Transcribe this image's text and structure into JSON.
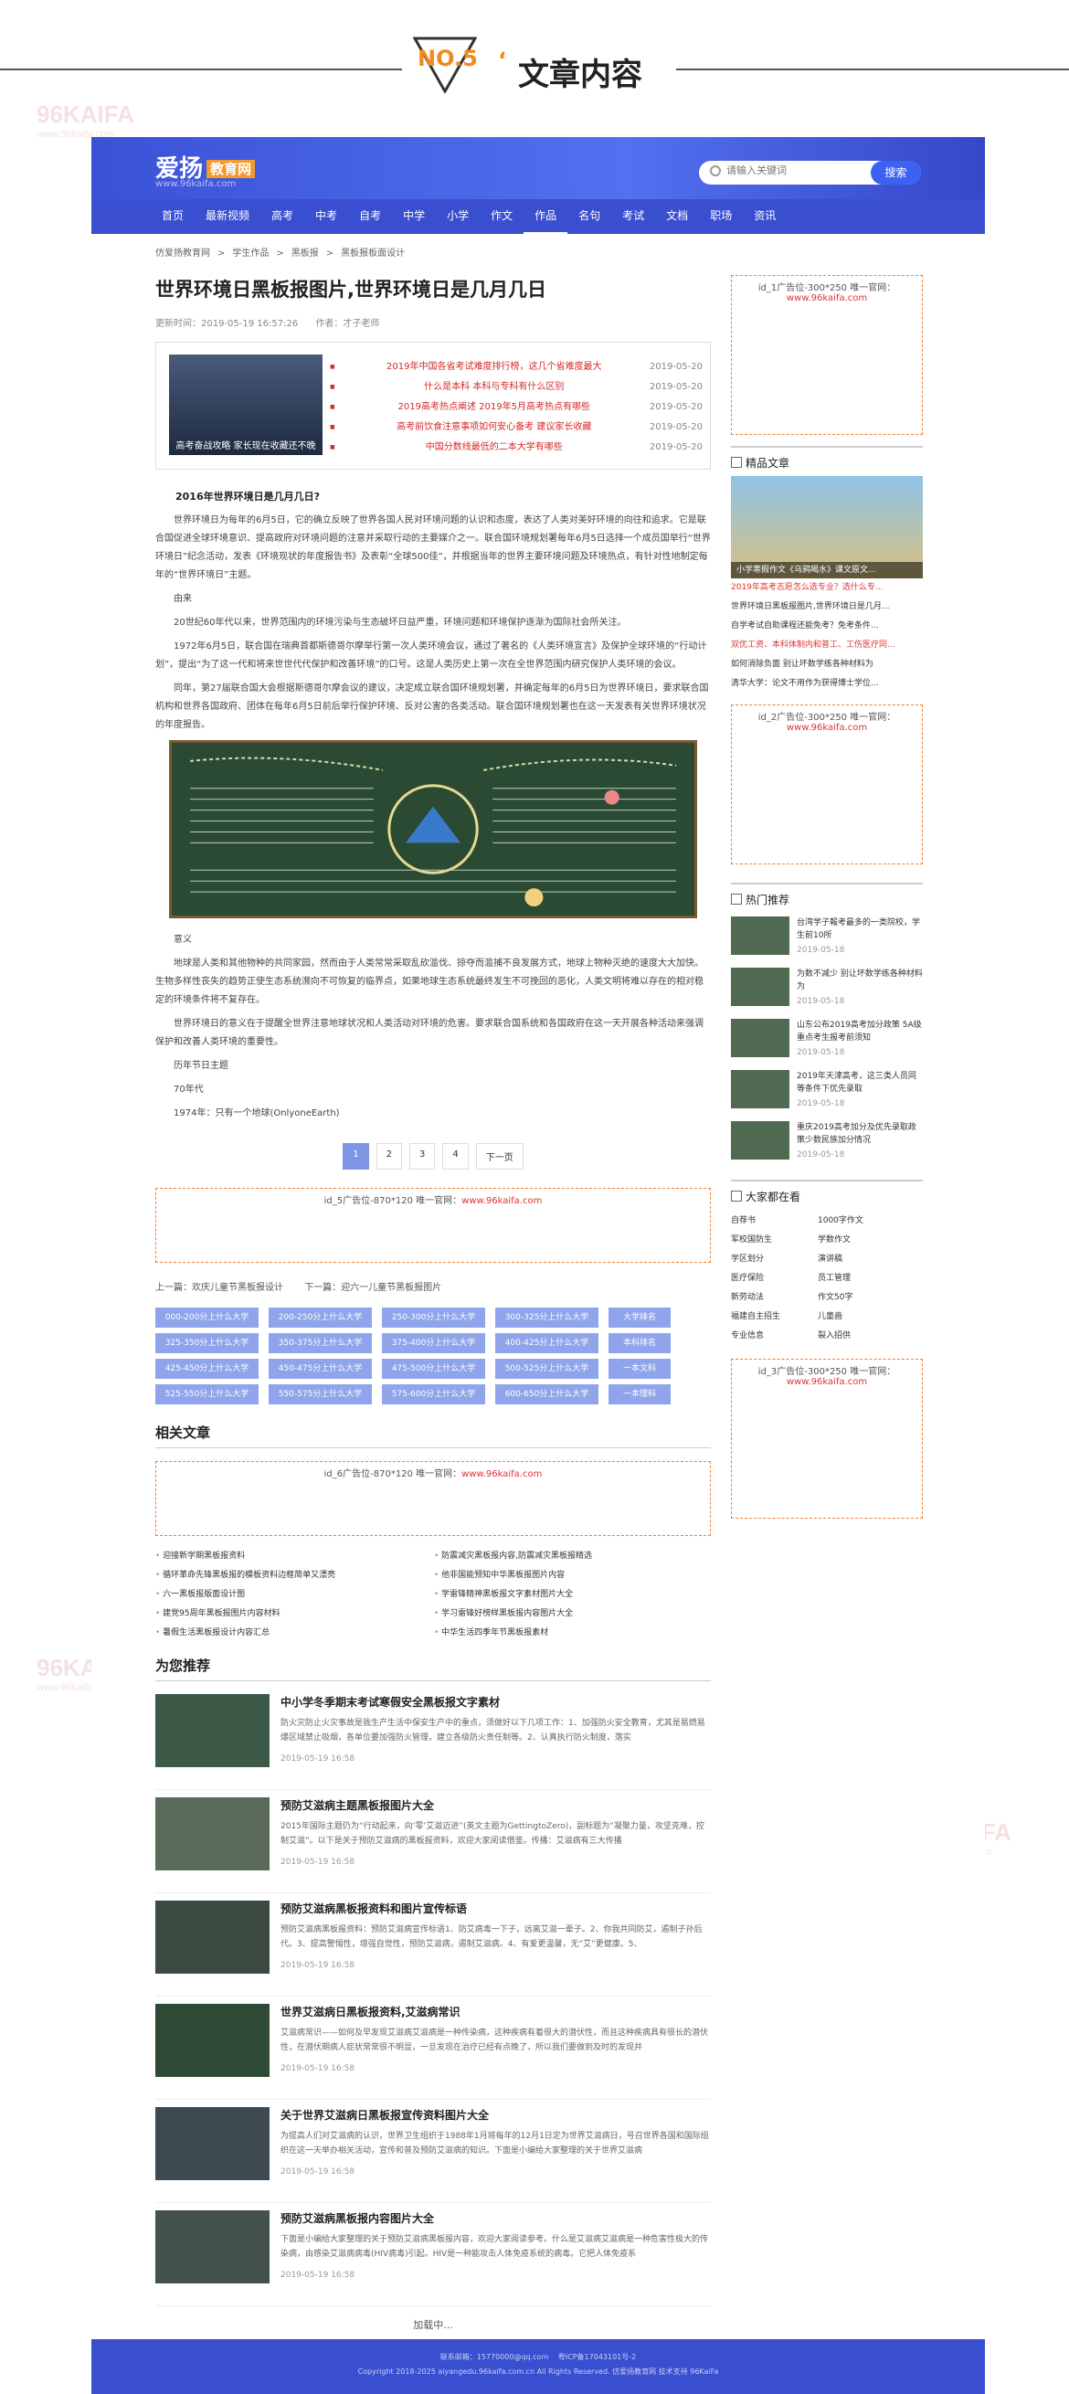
{
  "banner": {
    "no": "NO.5",
    "quote": "‘",
    "title": "文章内容"
  },
  "watermark": {
    "brand": "96KAIFA",
    "sub": "www.96kaifa.com"
  },
  "header": {
    "logo": "爱扬",
    "logo_tag": "教育网",
    "logo_domain": "www.96kaifa.com",
    "search_placeholder": "请输入关键词",
    "search_button": "搜索"
  },
  "nav": [
    "首页",
    "最新视频",
    "高考",
    "中考",
    "自考",
    "中学",
    "小学",
    "作文",
    "作品",
    "名句",
    "考试",
    "文档",
    "职场",
    "资讯"
  ],
  "breadcrumb": [
    "仿爱扬教育网",
    ">",
    "学生作品",
    ">",
    "黑板报",
    ">",
    "黑板报板面设计"
  ],
  "article": {
    "title": "世界环境日黑板报图片,世界环境日是几月几日",
    "date": "更新时间：2019-05-19 16:57:26",
    "author": "作者：才子老师",
    "thumb_caption": "高考奋战攻略 家长现在收藏还不晚",
    "related": [
      {
        "t": "2019年中国各省考试难度排行榜，这几个省难度最大",
        "d": "2019-05-20"
      },
      {
        "t": "什么是本科 本科与专科有什么区别",
        "d": "2019-05-20"
      },
      {
        "t": "2019高考热点阐述 2019年5月高考热点有哪些",
        "d": "2019-05-20"
      },
      {
        "t": "高考前饮食注意事项如何安心备考 建议家长收藏",
        "d": "2019-05-20"
      },
      {
        "t": "中国分数线最低的二本大学有哪些",
        "d": "2019-05-20"
      }
    ],
    "p1": "2016年世界环境日是几月几日?",
    "p2": "世界环境日为每年的6月5日，它的确立反映了世界各国人民对环境问题的认识和态度，表达了人类对美好环境的向往和追求。它是联合国促进全球环境意识、提高政府对环境问题的注意并采取行动的主要媒介之一。联合国环境规划署每年6月5日选择一个成员国举行“世界环境日”纪念活动，发表《环境现状的年度报告书》及表彰“全球500佳”，并根据当年的世界主要环境问题及环境热点，有针对性地制定每年的“世界环境日”主题。",
    "p3": "由来",
    "p4": "20世纪60年代以来，世界范围内的环境污染与生态破坏日益严重，环境问题和环境保护逐渐为国际社会所关注。",
    "p5": "1972年6月5日，联合国在瑞典首都斯德哥尔摩举行第一次人类环境会议，通过了著名的《人类环境宣言》及保护全球环境的“行动计划”，提出“为了这一代和将来世世代代保护和改善环境”的口号。这是人类历史上第一次在全世界范围内研究保护人类环境的会议。",
    "p6": "同年，第27届联合国大会根据斯德哥尔摩会议的建议，决定成立联合国环境规划署，并确定每年的6月5日为世界环境日，要求联合国机构和世界各国政府、团体在每年6月5日前后举行保护环境、反对公害的各类活动。联合国环境规划署也在这一天发表有关世界环境状况的年度报告。",
    "p7": "意义",
    "p8": "地球是人类和其他物种的共同家园，然而由于人类常常采取乱砍滥伐、掠夺而滥捕不良发展方式，地球上物种灭绝的速度大大加快。生物多样性丧失的趋势正使生态系统濒向不可恢复的临界点，如果地球生态系统最终发生不可挽回的恶化，人类文明将难以存在的相对稳定的环境条件将不复存在。",
    "p9": "世界环境日的意义在于提醒全世界注意地球状况和人类活动对环境的危害。要求联合国系统和各国政府在这一天开展各种活动来强调保护和改善人类环境的重要性。",
    "p10": "历年节日主题",
    "p11": "70年代",
    "p12": "1974年：只有一个地球(OnlyoneEarth)"
  },
  "pager": [
    "1",
    "2",
    "3",
    "4",
    "下一页"
  ],
  "ads": {
    "id5": "id_5广告位-870*120 唯一官网：",
    "id6": "id_6广告位-870*120 唯一官网：",
    "id1": "id_1广告位-300*250 唯一官网：",
    "id2": "id_2广告位-300*250 唯一官网：",
    "id3": "id_3广告位-300*250 唯一官网：",
    "url": "www.96kaifa.com"
  },
  "prevnext": {
    "prev": "上一篇：欢庆儿童节黑板报设计",
    "next": "下一篇：迎六一儿童节黑板报图片"
  },
  "score_grid": [
    "000-200分上什么大学",
    "200-250分上什么大学",
    "250-300分上什么大学",
    "300-325分上什么大学",
    "大学排名",
    "325-350分上什么大学",
    "350-375分上什么大学",
    "375-400分上什么大学",
    "400-425分上什么大学",
    "本科排名",
    "425-450分上什么大学",
    "450-475分上什么大学",
    "475-500分上什么大学",
    "500-525分上什么大学",
    "一本文科",
    "525-550分上什么大学",
    "550-575分上什么大学",
    "575-600分上什么大学",
    "600-650分上什么大学",
    "一本理科"
  ],
  "related_title": "相关文章",
  "related_links": [
    "迎接新学期黑板报资料",
    "防震减灾黑板报内容,防震减灾黑板报精选",
    "循环革命先锋黑板报的模板资料边框简单又漂亮",
    "他非国能预知中华黑板报图片内容",
    "六一黑板报版面设计图",
    "学雷锋精神黑板报文字素材图片大全",
    "建党95周年黑板报图片内容材料",
    "学习雷锋好榜样黑板报内容图片大全",
    "暑假生活黑板报设计内容汇总",
    "中华生活四季年节黑板报素材"
  ],
  "recommend_title": "为您推荐",
  "recommend": [
    {
      "t": "中小学冬季期末考试寒假安全黑板报文字素材",
      "s": "防火灾防止火灾事故是我生产生活中保安生产中的重点，须做好以下几项工作：1、加强防火安全教育，尤其是易燃易爆区域禁止吸烟，各单位要加强防火管理，建立各级防火责任制等。2、认真执行防火制度，落实",
      "d": "2019-05-19 16:58"
    },
    {
      "t": "预防艾滋病主题黑板报图片大全",
      "s": "2015年国际主题仍为“行动起来，向‘零’艾滋迈进”(英文主题为GettingtoZero)，副标题为“凝聚力量，攻坚克难，控制艾滋”。以下是关于预防艾滋病的黑板报资料，欢迎大家阅读借鉴。传播：艾滋病有三大传播",
      "d": "2019-05-19 16:58"
    },
    {
      "t": "预防艾滋病黑板报资料和图片宣传标语",
      "s": "预防艾滋病黑板报资料：预防艾滋病宣传标语1、防艾病毒一下子，远离艾滋一辈子。2、你我共同防艾，遏制子孙后代。3、提高警惕性，增强自觉性，预防艾滋病，遏制艾滋病。4、有爱更温馨，无“艾”更健康。5、",
      "d": "2019-05-19 16:58"
    },
    {
      "t": "世界艾滋病日黑板报资料,艾滋病常识",
      "s": "艾滋病常识——如何及早发现艾滋病艾滋病是一种传染病，这种疾病有着很大的潜伏性，而且这种疾病具有很长的潜伏性，在潜伏期病人症状常常很不明显，一旦发现在治疗已经有点晚了，所以我们要做到及时的发现并",
      "d": "2019-05-19 16:58"
    },
    {
      "t": "关于世界艾滋病日黑板报宣传资料图片大全",
      "s": "为提高人们对艾滋病的认识，世界卫生组织于1988年1月将每年的12月1日定为世界艾滋病日，号召世界各国和国际组织在这一天举办相关活动，宣传和普及预防艾滋病的知识。下面是小编给大家整理的关于世界艾滋病",
      "d": "2019-05-19 16:58"
    },
    {
      "t": "预防艾滋病黑板报内容图片大全",
      "s": "下面是小编给大家整理的关于预防艾滋病黑板报内容，欢迎大家阅读参考。什么是艾滋病艾滋病是一种危害性极大的传染病，由感染艾滋病病毒(HIV病毒)引起。HIV是一种能攻击人体免疫系统的病毒。它把人体免疫系",
      "d": "2019-05-19 16:58"
    }
  ],
  "loading": "加载中...",
  "side": {
    "jp_title": "精品文章",
    "jp_cap": "小学寒假作文《乌鸦喝水》课文原文...",
    "jp_items": [
      {
        "t": "2019年高考志愿怎么选专业？选什么专...",
        "r": true
      },
      {
        "t": "世界环境日黑板报图片,世界环境日是几月...",
        "r": false
      },
      {
        "t": "自学考试自助课程还能免考？免考条件...",
        "r": false
      },
      {
        "t": "双优工资、本科体制内和普工、工伤医疗同...",
        "r": true
      },
      {
        "t": "如何消除负面 别让坏数学练各种材料为",
        "r": false
      },
      {
        "t": "清华大学：论文不用作为获得博士学位...",
        "r": false
      }
    ],
    "hot_title": "热门推荐",
    "hot": [
      {
        "t": "台湾学子報考最多的一类院校，学生前10所",
        "d": "2019-05-18"
      },
      {
        "t": "为数不减少 别让坏数学练各种材料为",
        "d": "2019-05-18"
      },
      {
        "t": "山东公布2019高考加分政策 5A级重点考生报考前须知",
        "d": "2019-05-18"
      },
      {
        "t": "2019年天津高考，这三类人员同等条件下优先录取",
        "d": "2019-05-18"
      },
      {
        "t": "重庆2019高考加分及优先录取政策少数民族加分情况",
        "d": "2019-05-18"
      }
    ],
    "dj_title": "大家都在看",
    "dj": [
      "自荐书",
      "1000字作文",
      "军校国防生",
      "学数作文",
      "学区划分",
      "演讲稿",
      "医疗保险",
      "员工管理",
      "新劳动法",
      "作文50字",
      "福建自主招生",
      "儿童画",
      "专业信息",
      "裂入招供"
    ]
  },
  "footer": {
    "l1": "联系邮箱：15770000@qq.com 　粤ICP备17043101号-2",
    "l2": "Copyright 2018-2025 aiyangedu.96kaifa.com.cn All Rights Reserved. 仿爱扬教育网 技术支持 96KaiFa"
  }
}
